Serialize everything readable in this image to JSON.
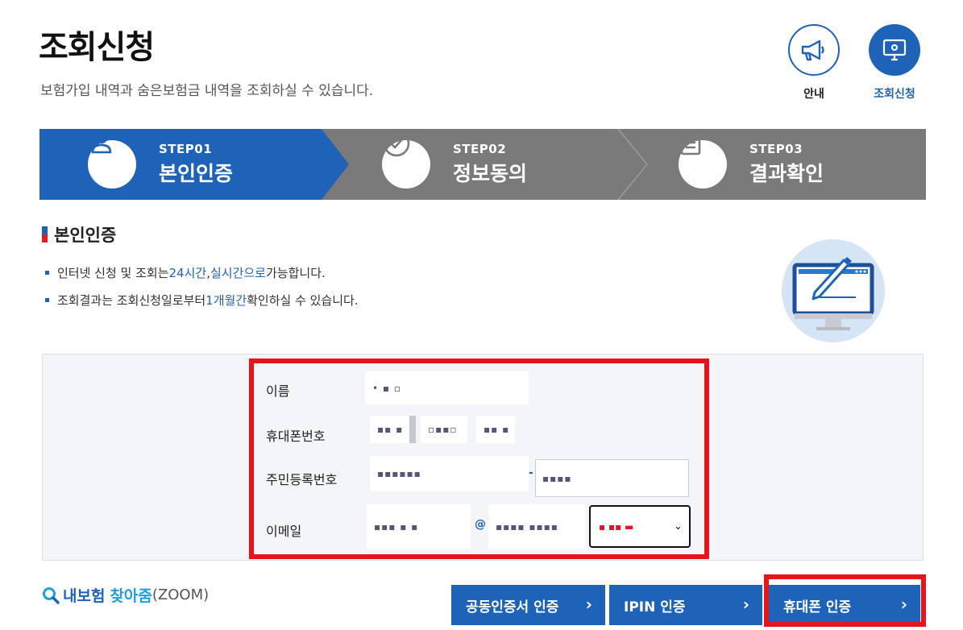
{
  "header": {
    "title": "조회신청",
    "subtitle": "보험가입 내역과 숨은보험금 내역을 조회하실 수 있습니다."
  },
  "top_icons": [
    {
      "label": "안내",
      "icon": "megaphone-icon"
    },
    {
      "label": "조회신청",
      "icon": "monitor-icon"
    }
  ],
  "steps": [
    {
      "num": "STEP01",
      "name": "본인인증",
      "icon": "user-icon",
      "active": true
    },
    {
      "num": "STEP02",
      "name": "정보동의",
      "icon": "check-circle-icon",
      "active": false
    },
    {
      "num": "STEP03",
      "name": "결과확인",
      "icon": "document-icon",
      "active": false
    }
  ],
  "section": {
    "title": "본인인증",
    "bullets": [
      {
        "pre": "인터넷 신청 및 조회는 ",
        "hl1": "24시간",
        "mid": ", ",
        "hl2": "실시간으로",
        "post": " 가능합니다."
      },
      {
        "pre": "조회결과는 조회신청일로부터 ",
        "hl1": "1개월간",
        "post": " 확인하실 수 있습니다."
      }
    ]
  },
  "form": {
    "name_label": "이름",
    "name_value": "• ▪ ▫",
    "phone_label": "휴대폰번호",
    "phone_values": [
      "▪▪ ▪",
      "▫▪▪▫",
      "▪▪ ▪"
    ],
    "rrn_label": "주민등록번호",
    "rrn_values": [
      "▪▪▪▪▪▪",
      "▪▪▪▪"
    ],
    "email_label": "이메일",
    "email_values": [
      "▪▪▪ ▪ ▪",
      "▪▪▪▪ ▪▪▪▪"
    ],
    "email_at": "@",
    "email_domain_selected": "▪ ▪▪ ▬",
    "rrn_dash": "-"
  },
  "zoom": {
    "part1": "내보험",
    "part2": "찾아줌",
    "part3": "(ZOOM)"
  },
  "buttons": [
    {
      "label": "공동인증서 인증"
    },
    {
      "label": "IPIN 인증"
    },
    {
      "label": "휴대폰 인증"
    }
  ],
  "colors": {
    "accent": "#1e63b8",
    "step_inactive": "#7a7a7a",
    "highlight_box": "#e8141c"
  }
}
